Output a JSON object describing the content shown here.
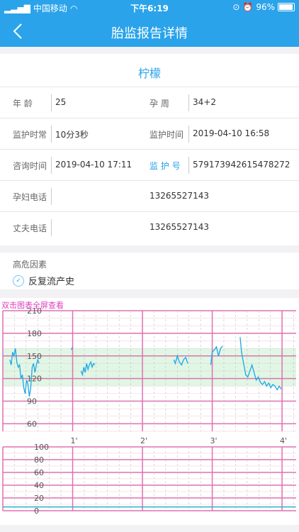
{
  "status_bar": {
    "carrier": "中国移动",
    "time": "下午6:19",
    "battery_percent": "96%",
    "battery_level": 0.96
  },
  "nav": {
    "title": "胎监报告详情"
  },
  "patient": {
    "name": "柠檬",
    "age_label": "年 龄",
    "age_value": "25",
    "week_label": "孕 周",
    "week_value": "34+2",
    "duration_label": "监护时常",
    "duration_value": "10分3秒",
    "monitor_time_label": "监护时间",
    "monitor_time_value": "2019-04-10 16:58",
    "consult_time_label": "咨询时间",
    "consult_time_value": "2019-04-10 17:11",
    "monitor_no_label": "监 护 号",
    "monitor_no_value": "579173942615478272",
    "mother_phone_label": "孕妇电话",
    "mother_phone_value": "13265527143",
    "husband_phone_label": "丈夫电话",
    "husband_phone_value": "13265527143"
  },
  "risk": {
    "title": "高危因素",
    "items": [
      "反复流产史"
    ]
  },
  "chart": {
    "hint": "双击图表全屏查看",
    "fhr_ticks": [
      "210",
      "180",
      "150",
      "120",
      "90",
      "60"
    ],
    "toco_ticks": [
      "100",
      "80",
      "60",
      "40",
      "20",
      "0"
    ],
    "minute_labels": [
      "1'",
      "2'",
      "3'",
      "4'"
    ]
  },
  "chart_data": {
    "type": "line",
    "title": "",
    "fhr": {
      "ylim": [
        50,
        210
      ],
      "normal_band": [
        110,
        160
      ],
      "x_unit": "minutes",
      "segments": [
        [
          [
            0.1,
            145
          ],
          [
            0.12,
            138
          ],
          [
            0.14,
            155
          ],
          [
            0.16,
            150
          ],
          [
            0.18,
            160
          ],
          [
            0.2,
            142
          ],
          [
            0.22,
            135
          ],
          [
            0.24,
            138
          ],
          [
            0.26,
            120
          ],
          [
            0.28,
            125
          ],
          [
            0.3,
            108
          ],
          [
            0.32,
            100
          ],
          [
            0.34,
            118
          ],
          [
            0.36,
            112
          ],
          [
            0.38,
            96
          ],
          [
            0.4,
            108
          ],
          [
            0.42,
            135
          ],
          [
            0.44,
            140
          ],
          [
            0.46,
            128
          ],
          [
            0.48,
            138
          ],
          [
            0.5,
            145
          ],
          [
            0.52,
            140
          ]
        ],
        [
          [
            0.98,
            158
          ],
          [
            1.0,
            162
          ]
        ],
        [
          [
            1.12,
            130
          ],
          [
            1.14,
            125
          ],
          [
            1.16,
            135
          ],
          [
            1.18,
            128
          ],
          [
            1.2,
            140
          ],
          [
            1.22,
            132
          ],
          [
            1.24,
            138
          ],
          [
            1.26,
            142
          ],
          [
            1.28,
            135
          ],
          [
            1.3,
            140
          ],
          [
            1.32,
            138
          ]
        ],
        [
          [
            2.45,
            145
          ],
          [
            2.47,
            140
          ],
          [
            2.5,
            150
          ],
          [
            2.53,
            142
          ],
          [
            2.56,
            138
          ],
          [
            2.59,
            145
          ],
          [
            2.62,
            148
          ],
          [
            2.65,
            140
          ]
        ],
        [
          [
            2.98,
            138
          ],
          [
            3.0,
            155
          ],
          [
            3.03,
            158
          ],
          [
            3.06,
            162
          ],
          [
            3.09,
            150
          ],
          [
            3.12,
            160
          ],
          [
            3.15,
            163
          ]
        ],
        [
          [
            3.4,
            175
          ],
          [
            3.42,
            155
          ],
          [
            3.45,
            140
          ],
          [
            3.48,
            125
          ],
          [
            3.51,
            122
          ],
          [
            3.54,
            130
          ],
          [
            3.57,
            138
          ],
          [
            3.6,
            128
          ],
          [
            3.63,
            118
          ],
          [
            3.66,
            122
          ],
          [
            3.69,
            115
          ],
          [
            3.72,
            112
          ],
          [
            3.75,
            116
          ],
          [
            3.78,
            110
          ],
          [
            3.81,
            114
          ],
          [
            3.84,
            108
          ],
          [
            3.87,
            112
          ],
          [
            3.9,
            110
          ],
          [
            3.93,
            105
          ],
          [
            3.96,
            110
          ],
          [
            3.99,
            106
          ]
        ]
      ]
    },
    "toco": {
      "ylim": [
        0,
        100
      ],
      "values": [
        [
          0,
          6
        ],
        [
          4.2,
          6
        ]
      ]
    }
  }
}
